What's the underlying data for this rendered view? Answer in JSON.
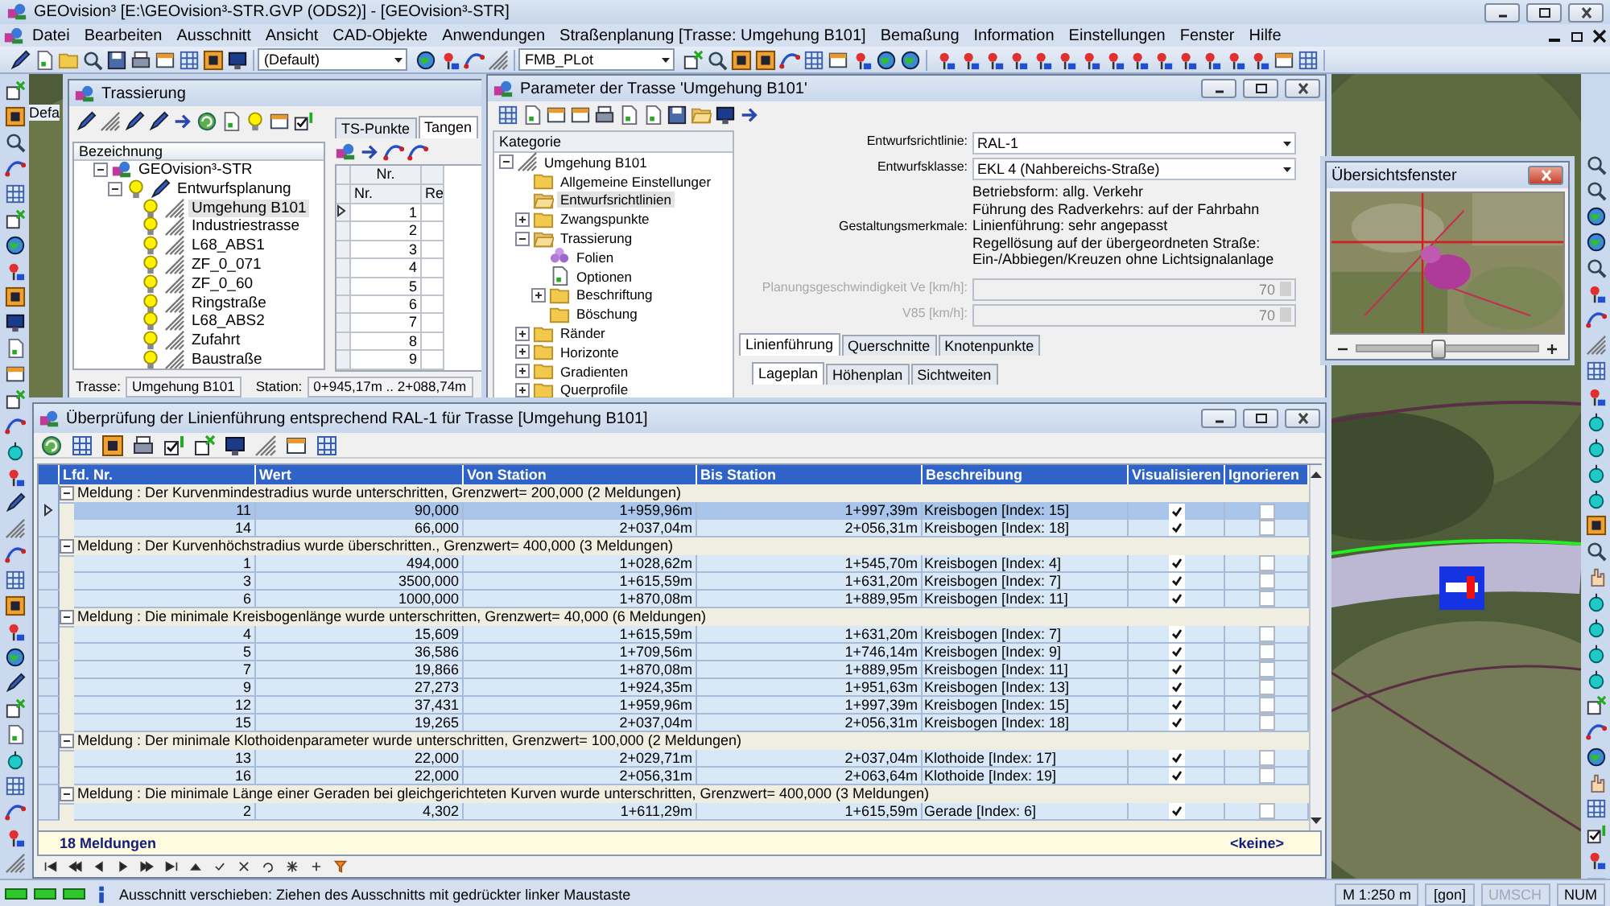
{
  "window": {
    "title": "GEOvision³  [E:\\GEOvision³-STR.GVP (ODS2)] - [GEOvision³-STR]"
  },
  "menu": [
    "Datei",
    "Bearbeiten",
    "Ausschnitt",
    "Ansicht",
    "CAD-Objekte",
    "Anwendungen",
    "Straßenplanung [Trasse: Umgehung B101]",
    "Bemaßung",
    "Information",
    "Einstellungen",
    "Fenster",
    "Hilfe"
  ],
  "toolbar": {
    "combos": [
      {
        "value": "(Default)"
      },
      {
        "value": "FMB_PLot"
      }
    ]
  },
  "document_tab": "Defa",
  "trassierung": {
    "title": "Trassierung",
    "tree_header": "Bezeichnung",
    "tree": [
      {
        "label": "GEOvision³-STR",
        "kind": "project",
        "expanded": true,
        "selected": false,
        "children": [
          {
            "label": "Entwurfsplanung",
            "kind": "plan",
            "expanded": true,
            "selected": false,
            "children": [
              {
                "label": "Umgehung B101",
                "kind": "route",
                "selected": true
              },
              {
                "label": "Industriestrasse",
                "kind": "route",
                "selected": false
              },
              {
                "label": "L68_ABS1",
                "kind": "route",
                "selected": false
              },
              {
                "label": "ZF_0_071",
                "kind": "route",
                "selected": false
              },
              {
                "label": "ZF_0_60",
                "kind": "route",
                "selected": false
              },
              {
                "label": "Ringstraße",
                "kind": "route",
                "selected": false
              },
              {
                "label": "L68_ABS2",
                "kind": "route",
                "selected": false
              },
              {
                "label": "Zufahrt",
                "kind": "route",
                "selected": false
              },
              {
                "label": "Baustraße",
                "kind": "route",
                "selected": false
              }
            ]
          }
        ]
      }
    ],
    "tabs": [
      {
        "label": "TS-Punkte",
        "selected": false
      },
      {
        "label": "Tangen",
        "selected": true
      }
    ],
    "grid": {
      "header": "Nr.",
      "columns": [
        "Nr.",
        "Re"
      ],
      "rows": [
        {
          "nr": "1",
          "selected": true
        },
        {
          "nr": "2",
          "selected": false
        },
        {
          "nr": "3",
          "selected": false
        },
        {
          "nr": "4",
          "selected": false
        },
        {
          "nr": "5",
          "selected": false
        },
        {
          "nr": "6",
          "selected": false
        },
        {
          "nr": "7",
          "selected": false
        },
        {
          "nr": "8",
          "selected": false
        },
        {
          "nr": "9",
          "selected": false
        }
      ]
    },
    "trasse_label": "Trasse:",
    "trasse": "Umgehung B101",
    "station_label": "Station:",
    "station": "0+945,17m .. 2+088,74m"
  },
  "parameter": {
    "title": "Parameter der Trasse 'Umgehung B101'",
    "category_header": "Kategorie",
    "tree": [
      {
        "label": "Umgehung B101",
        "kind": "road",
        "expanded": true,
        "selected": false,
        "children": [
          {
            "label": "Allgemeine Einstellunger",
            "kind": "folder",
            "selected": false
          },
          {
            "label": "Entwurfsrichtlinien",
            "kind": "open-folder",
            "selected": true
          },
          {
            "label": "Zwangspunkte",
            "kind": "folder",
            "expanded": false,
            "selected": false
          },
          {
            "label": "Trassierung",
            "kind": "open-folder",
            "expanded": true,
            "selected": false,
            "children": [
              {
                "label": "Folien",
                "kind": "layers",
                "selected": false
              },
              {
                "label": "Optionen",
                "kind": "document",
                "selected": false
              },
              {
                "label": "Beschriftung",
                "kind": "folder",
                "expanded": false,
                "selected": false
              },
              {
                "label": "Böschung",
                "kind": "folder",
                "selected": false
              }
            ]
          },
          {
            "label": "Ränder",
            "kind": "folder",
            "expanded": false,
            "selected": false
          },
          {
            "label": "Horizonte",
            "kind": "folder",
            "expanded": false,
            "selected": false
          },
          {
            "label": "Gradienten",
            "kind": "folder",
            "expanded": false,
            "selected": false
          },
          {
            "label": "Querprofile",
            "kind": "folder",
            "expanded": false,
            "selected": false
          }
        ]
      }
    ],
    "fields": [
      {
        "label": "Entwurfsrichtlinie:",
        "value": "RAL-1",
        "kind": "dropdown",
        "disabled": false
      },
      {
        "label": "Entwurfsklasse:",
        "value": "EKL 4 (Nahbereichs-Straße)",
        "kind": "dropdown",
        "disabled": false
      },
      {
        "label": "Gestaltungsmerkmale:",
        "kind": "text",
        "lines": [
          "Betriebsform: allg. Verkehr",
          "Führung des Radverkehrs: auf der Fahrbahn",
          "Linienführung: sehr angepasst",
          "Regellösung auf der übergeordneten Straße: Ein-/Abbiegen/Kreuzen ohne Lichtsignalanlage"
        ]
      },
      {
        "label": "Planungsgeschwindigkeit Ve [km/h]:",
        "value": "70",
        "kind": "spin",
        "disabled": true
      },
      {
        "label": "V85 [km/h]:",
        "value": "70",
        "kind": "spin",
        "disabled": true
      }
    ],
    "tabs": [
      {
        "label": "Linienführung",
        "selected": true
      },
      {
        "label": "Querschnitte",
        "selected": false
      },
      {
        "label": "Knotenpunkte",
        "selected": false
      }
    ],
    "subtabs": [
      {
        "label": "Lageplan",
        "selected": true
      },
      {
        "label": "Höhenplan",
        "selected": false
      },
      {
        "label": "Sichtweiten",
        "selected": false
      }
    ]
  },
  "overview": {
    "title": "Übersichtsfenster",
    "zoom": {
      "level": 0.45
    }
  },
  "check": {
    "title": "Überprüfung der Linienführung entsprechend RAL-1 für Trasse [Umgehung B101]",
    "columns": [
      "Lfd. Nr.",
      "Wert",
      "Von Station",
      "Bis Station",
      "Beschreibung",
      "Visualisieren",
      "Ignorieren"
    ],
    "groups": [
      {
        "title": "Meldung : Der Kurvenmindestradius wurde unterschritten, Grenzwert= 200,000 (2 Meldungen)",
        "expanded": true,
        "rows": [
          {
            "nr": "11",
            "wert": "90,000",
            "von": "1+959,96m",
            "bis": "1+997,39m",
            "text": "Kreisbogen [Index: 15]",
            "visualize": true,
            "ignore": false,
            "selected": true
          },
          {
            "nr": "14",
            "wert": "66,000",
            "von": "2+037,04m",
            "bis": "2+056,31m",
            "text": "Kreisbogen [Index: 18]",
            "visualize": true,
            "ignore": false,
            "selected": false
          }
        ]
      },
      {
        "title": "Meldung : Der Kurvenhöchstradius wurde überschritten., Grenzwert= 400,000 (3 Meldungen)",
        "expanded": true,
        "rows": [
          {
            "nr": "1",
            "wert": "494,000",
            "von": "1+028,62m",
            "bis": "1+545,70m",
            "text": "Kreisbogen [Index: 4]",
            "visualize": true,
            "ignore": false,
            "selected": false
          },
          {
            "nr": "3",
            "wert": "3500,000",
            "von": "1+615,59m",
            "bis": "1+631,20m",
            "text": "Kreisbogen [Index: 7]",
            "visualize": true,
            "ignore": false,
            "selected": false
          },
          {
            "nr": "6",
            "wert": "1000,000",
            "von": "1+870,08m",
            "bis": "1+889,95m",
            "text": "Kreisbogen [Index: 11]",
            "visualize": true,
            "ignore": false,
            "selected": false
          }
        ]
      },
      {
        "title": "Meldung : Die minimale Kreisbogenlänge wurde unterschritten, Grenzwert= 40,000 (6 Meldungen)",
        "expanded": true,
        "rows": [
          {
            "nr": "4",
            "wert": "15,609",
            "von": "1+615,59m",
            "bis": "1+631,20m",
            "text": "Kreisbogen [Index: 7]",
            "visualize": true,
            "ignore": false,
            "selected": false
          },
          {
            "nr": "5",
            "wert": "36,586",
            "von": "1+709,56m",
            "bis": "1+746,14m",
            "text": "Kreisbogen [Index: 9]",
            "visualize": true,
            "ignore": false,
            "selected": false
          },
          {
            "nr": "7",
            "wert": "19,866",
            "von": "1+870,08m",
            "bis": "1+889,95m",
            "text": "Kreisbogen [Index: 11]",
            "visualize": true,
            "ignore": false,
            "selected": false
          },
          {
            "nr": "9",
            "wert": "27,273",
            "von": "1+924,35m",
            "bis": "1+951,63m",
            "text": "Kreisbogen [Index: 13]",
            "visualize": true,
            "ignore": false,
            "selected": false
          },
          {
            "nr": "12",
            "wert": "37,431",
            "von": "1+959,96m",
            "bis": "1+997,39m",
            "text": "Kreisbogen [Index: 15]",
            "visualize": true,
            "ignore": false,
            "selected": false
          },
          {
            "nr": "15",
            "wert": "19,265",
            "von": "2+037,04m",
            "bis": "2+056,31m",
            "text": "Kreisbogen [Index: 18]",
            "visualize": true,
            "ignore": false,
            "selected": false
          }
        ]
      },
      {
        "title": "Meldung : Der minimale Klothoidenparameter wurde unterschritten, Grenzwert= 100,000 (2 Meldungen)",
        "expanded": true,
        "rows": [
          {
            "nr": "13",
            "wert": "22,000",
            "von": "2+029,71m",
            "bis": "2+037,04m",
            "text": "Klothoide [Index: 17]",
            "visualize": true,
            "ignore": false,
            "selected": false
          },
          {
            "nr": "16",
            "wert": "22,000",
            "von": "2+056,31m",
            "bis": "2+063,64m",
            "text": "Klothoide [Index: 19]",
            "visualize": true,
            "ignore": false,
            "selected": false
          }
        ]
      },
      {
        "title": "Meldung : Die minimale Länge einer Geraden bei gleichgerichteten Kurven wurde unterschritten, Grenzwert= 400,000 (3 Meldungen)",
        "expanded": true,
        "rows": [
          {
            "nr": "2",
            "wert": "4,302",
            "von": "1+611,29m",
            "bis": "1+615,59m",
            "text": "Gerade [Index: 6]",
            "visualize": true,
            "ignore": false,
            "selected": false
          }
        ]
      }
    ],
    "count": "18 Meldungen",
    "filter": "<keine>"
  },
  "status_bar": {
    "message": "Ausschnitt verschieben: Ziehen des Ausschnitts mit gedrückter linker Maustaste",
    "scale": "M 1:250  m",
    "unit": "[gon]",
    "indicators": [
      {
        "label": "UMSCH",
        "on": false
      },
      {
        "label": "NUM",
        "on": true
      }
    ]
  }
}
